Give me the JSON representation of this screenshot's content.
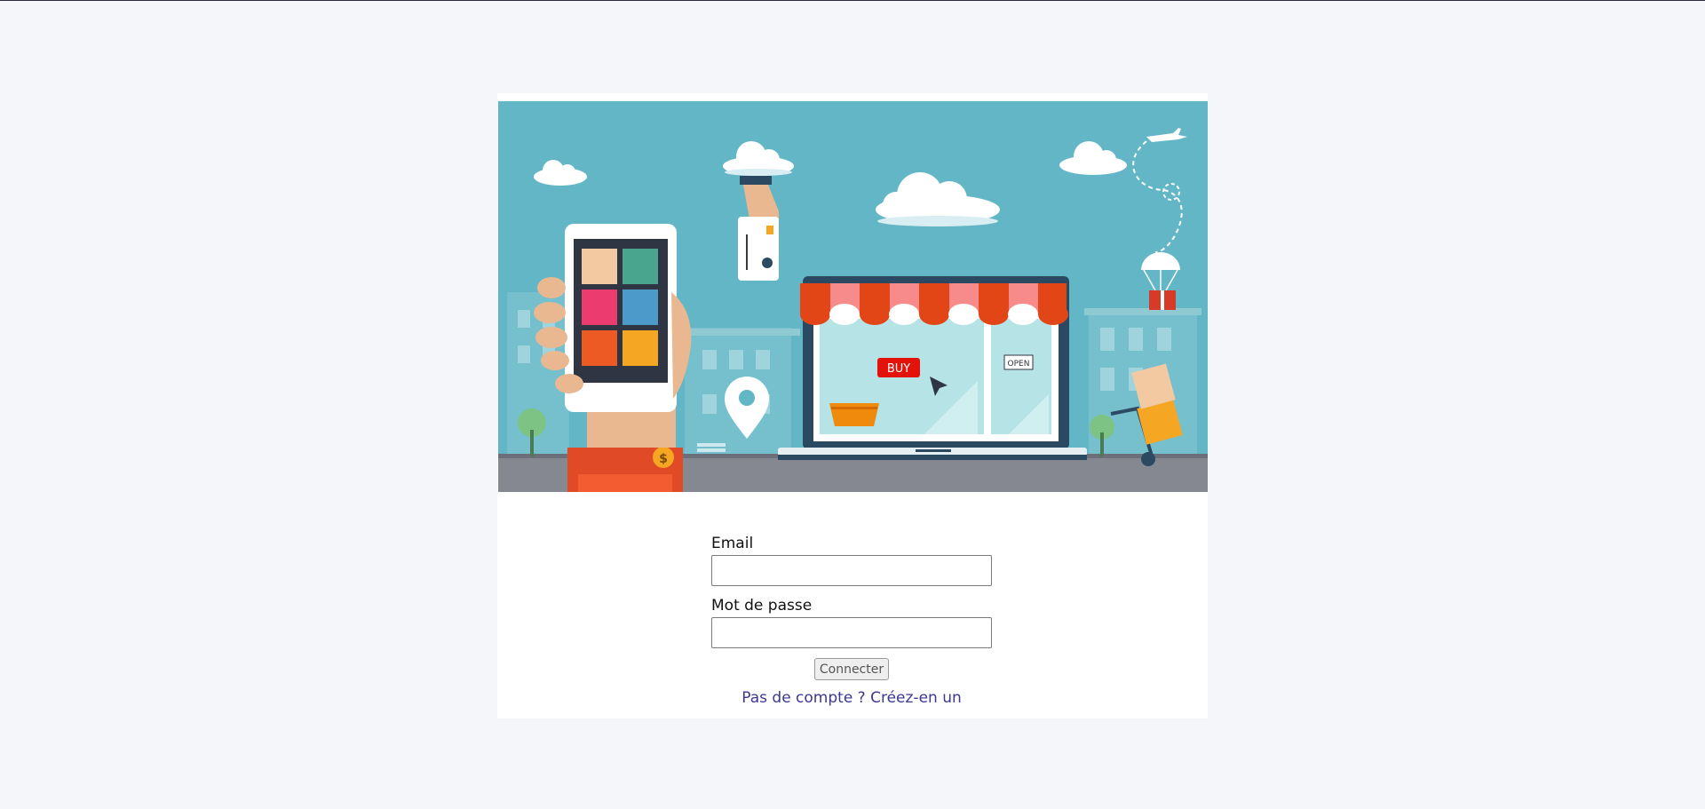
{
  "hero": {
    "buy_sign": "BUY",
    "open_sign": "OPEN",
    "coin_symbol": "$",
    "colors": {
      "sky": "#62b6c5",
      "road": "#858791",
      "awning_red": "#e34616",
      "awning_pink": "#f78b8b",
      "laptop": "#2b4a62",
      "sleeve": "#e04a26"
    }
  },
  "login_form": {
    "email_label": "Email",
    "email_value": "",
    "password_label": "Mot de passe",
    "password_value": "",
    "submit_label": "Connecter",
    "signup_link": "Pas de compte ? Créez-en un"
  }
}
